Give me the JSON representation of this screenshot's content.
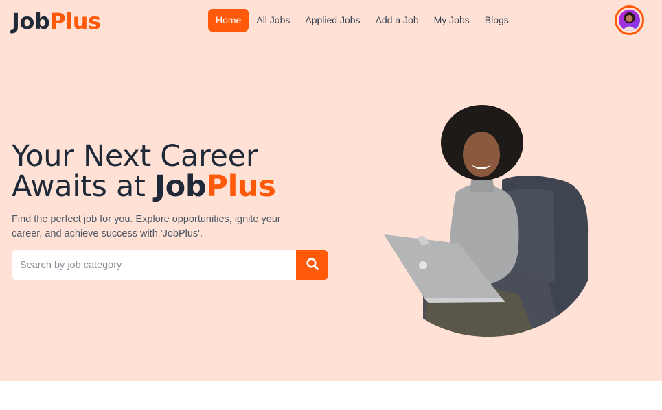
{
  "brand": {
    "name_part1": "Job",
    "name_part2": "Plus"
  },
  "nav": {
    "items": [
      {
        "label": "Home",
        "active": true
      },
      {
        "label": "All Jobs",
        "active": false
      },
      {
        "label": "Applied Jobs",
        "active": false
      },
      {
        "label": "Add a Job",
        "active": false
      },
      {
        "label": "My Jobs",
        "active": false
      },
      {
        "label": "Blogs",
        "active": false
      }
    ]
  },
  "hero": {
    "headline_line1": "Your Next Career",
    "headline_line2_prefix": "Awaits at ",
    "headline_brand_part1": "Job",
    "headline_brand_part2": "Plus",
    "description": "Find the perfect job for you. Explore opportunities, ignite your career, and achieve success with 'JobPlus'.",
    "search_placeholder": "Search by job category"
  },
  "icons": {
    "search": "search-icon",
    "avatar": "user-avatar",
    "hero_image": "woman-with-laptop-illustration"
  },
  "colors": {
    "accent": "#ff5a0a",
    "hero_bg": "#ffe1d5",
    "text_dark": "#1f2937"
  }
}
